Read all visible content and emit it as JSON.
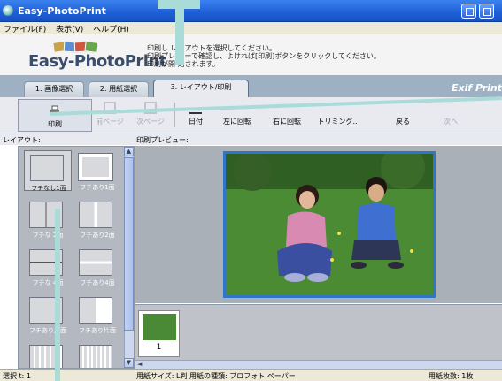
{
  "window": {
    "title": "Easy-PhotoPrint"
  },
  "menu": [
    "ファイル(F)",
    "表示(V)",
    "ヘルプ(H)"
  ],
  "brand": {
    "logo_text": "Easy-PhotoPrint"
  },
  "instructions": [
    "印刷し  レイアウトを選択してください。",
    "印刷プレ  ューで確認し、よければ[印刷]ボタンをクリックしてください。",
    "印刷が開  始されます。"
  ],
  "tabs": [
    {
      "label": "1. 画像選択"
    },
    {
      "label": "2. 用紙選択"
    },
    {
      "label": "3. レイアウト/印刷",
      "active": true
    }
  ],
  "exif_logo": "Exif Print",
  "toolbar": {
    "print": "印刷",
    "prev_page": "前ページ",
    "next_page": "次ページ",
    "date": "日付",
    "rotate_left": "左に回転",
    "rotate_right": "右に回転",
    "trimming": "トリミング..",
    "back": "戻る",
    "next": "次へ"
  },
  "labels": {
    "layout": "レイアウト:",
    "preview": "印刷プレビュー:"
  },
  "layouts": [
    {
      "label": "フチなし1面",
      "selected": true
    },
    {
      "label": "フチあり1面"
    },
    {
      "label": "フチな 2面"
    },
    {
      "label": "フチあり2面"
    },
    {
      "label": "フチな 4面"
    },
    {
      "label": "フチあり4面"
    },
    {
      "label": "フチあり片面"
    },
    {
      "label": "フチあり片面"
    }
  ],
  "filmstrip": {
    "page_number": "1"
  },
  "status": {
    "selected": "選択 t: 1",
    "paper_size": "用紙サイズ: L判 用紙の種類: プロフォト ペーパー",
    "print_count": "用紙枚数: 1枚"
  },
  "colors": {
    "titlebar": "#1e5fd6",
    "tabbar": "#9eb1c4",
    "photo_border": "#2f77c4",
    "pointer": "#a9dcd8"
  }
}
